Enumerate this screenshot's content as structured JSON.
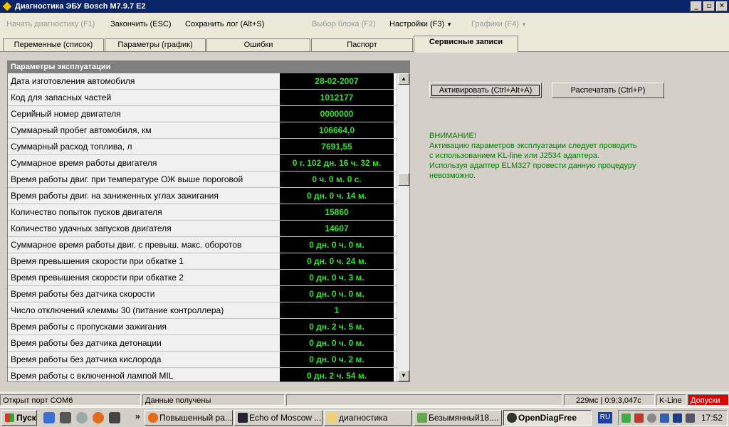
{
  "window": {
    "title": "Диагностика ЭБУ Bosch M7.9.7 E2",
    "minimize": "_",
    "maximize": "▫",
    "close": "✕"
  },
  "menu": {
    "start_diag": "Начать диагностику (F1)",
    "finish": "Закончить (ESC)",
    "save_log": "Сохранить лог (Alt+S)",
    "select_block": "Выбор блока (F2)",
    "settings": "Настройки (F3)",
    "graphs": "Графики (F4)"
  },
  "tabs": [
    {
      "label": "Переменные (список)"
    },
    {
      "label": "Параметры (график)"
    },
    {
      "label": "Ошибки"
    },
    {
      "label": "Паспорт"
    },
    {
      "label": "Сервисные записи"
    }
  ],
  "grid": {
    "header": "Параметры эксплуатации",
    "rows": [
      {
        "name": "Дата изготовления автомобиля",
        "value": "28-02-2007"
      },
      {
        "name": "Код для запасных частей",
        "value": "1012177"
      },
      {
        "name": "Серийный номер двигателя",
        "value": "0000000"
      },
      {
        "name": "Суммарный пробег автомобиля, км",
        "value": "106664,0"
      },
      {
        "name": "Суммарный расход топлива, л",
        "value": "7691,55"
      },
      {
        "name": "Суммарное время работы двигателя",
        "value": "0 г. 102 дн. 16 ч. 32 м."
      },
      {
        "name": "Время работы двиг. при температуре ОЖ выше пороговой",
        "value": "0 ч. 0 м. 0 с."
      },
      {
        "name": "Время работы двиг. на заниженных углах зажигания",
        "value": "0 дн. 0 ч. 14 м."
      },
      {
        "name": "Количество попыток пусков двигателя",
        "value": "15860"
      },
      {
        "name": "Количество удачных запусков двигателя",
        "value": "14607"
      },
      {
        "name": "Суммарное время работы двиг. с превыш. макс. оборотов",
        "value": "0 дн. 0 ч. 0 м."
      },
      {
        "name": "Время превышения скорости при обкатке 1",
        "value": "0 дн. 0 ч. 24 м."
      },
      {
        "name": "Время превышения скорости при обкатке 2",
        "value": "0 дн. 0 ч. 3 м."
      },
      {
        "name": "Время работы без датчика скорости",
        "value": "0 дн. 0 ч. 0 м."
      },
      {
        "name": "Число отключений клеммы 30 (питание контроллера)",
        "value": "1"
      },
      {
        "name": "Время работы с пропусками зажигания",
        "value": "0 дн. 2 ч. 5 м."
      },
      {
        "name": "Время работы без датчика детонации",
        "value": "0 дн. 0 ч. 0 м."
      },
      {
        "name": "Время работы без датчика кислорода",
        "value": "0 дн. 0 ч. 2 м."
      },
      {
        "name": "Время работы с включенной лампой MIL",
        "value": "0 дн. 2 ч. 54 м."
      }
    ]
  },
  "actions": {
    "activate": "Активировать (Ctrl+Alt+A)",
    "print": "Распечатать (Ctrl+P)"
  },
  "notice": {
    "line1": "ВНИМАНИЕ!",
    "line2": "Активацию параметров эксплуатации следует проводить",
    "line3": "с использованием KL-line или J2534 адаптера.",
    "line4": "Используя адаптер ELM327 провести данную процедуру",
    "line5": "невозможно."
  },
  "status": {
    "port": "Открыт порт COM6",
    "data": "Данные получены",
    "timing": "229мс | 0:9:3,047с",
    "protocol": "K-Line",
    "tolerances": "Допуски",
    "tolerances_color": "#e00000"
  },
  "taskbar": {
    "start": "Пуск",
    "more": "»",
    "tasks": [
      {
        "label": "Повышенный ра..."
      },
      {
        "label": "Echo of Moscow ..."
      },
      {
        "label": "диагностика"
      },
      {
        "label": "Безымянный18...."
      },
      {
        "label": "OpenDiagFree"
      }
    ],
    "lang": "RU",
    "clock": "17:52"
  },
  "colors": {
    "value_text": "#31e12c",
    "value_bg": "#000000",
    "notice_text": "#008000",
    "titlebar": "#0a246a"
  }
}
